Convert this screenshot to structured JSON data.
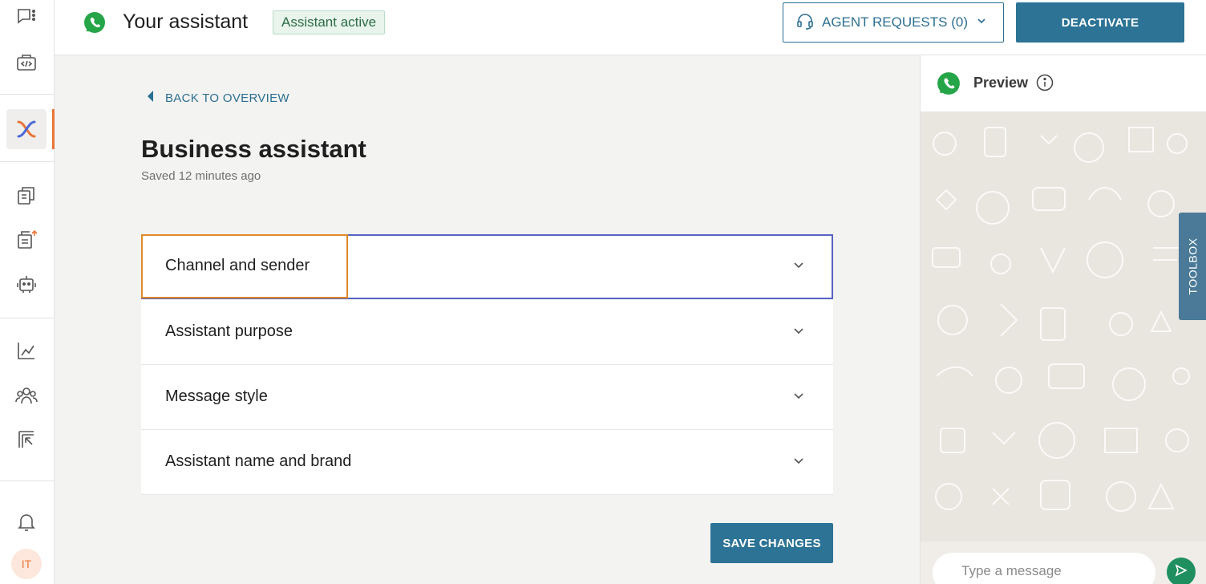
{
  "header": {
    "title": "Your assistant",
    "status_badge": "Assistant active",
    "agent_requests_label": "AGENT REQUESTS (0)",
    "deactivate_label": "DEACTIVATE"
  },
  "main": {
    "back_label": "BACK TO OVERVIEW",
    "heading": "Business assistant",
    "saved_text": "Saved 12 minutes ago",
    "sections": [
      {
        "label": "Channel and sender"
      },
      {
        "label": "Assistant purpose"
      },
      {
        "label": "Message style"
      },
      {
        "label": "Assistant name and brand"
      }
    ],
    "save_label": "SAVE CHANGES"
  },
  "preview": {
    "title": "Preview",
    "message_placeholder": "Type a message",
    "toolbox_label": "TOOLBOX"
  },
  "user": {
    "initials": "IT"
  },
  "colors": {
    "accent": "#2c7396",
    "orange": "#e8763a",
    "whatsapp_green": "#25a548",
    "focus_border": "#5963c4"
  }
}
